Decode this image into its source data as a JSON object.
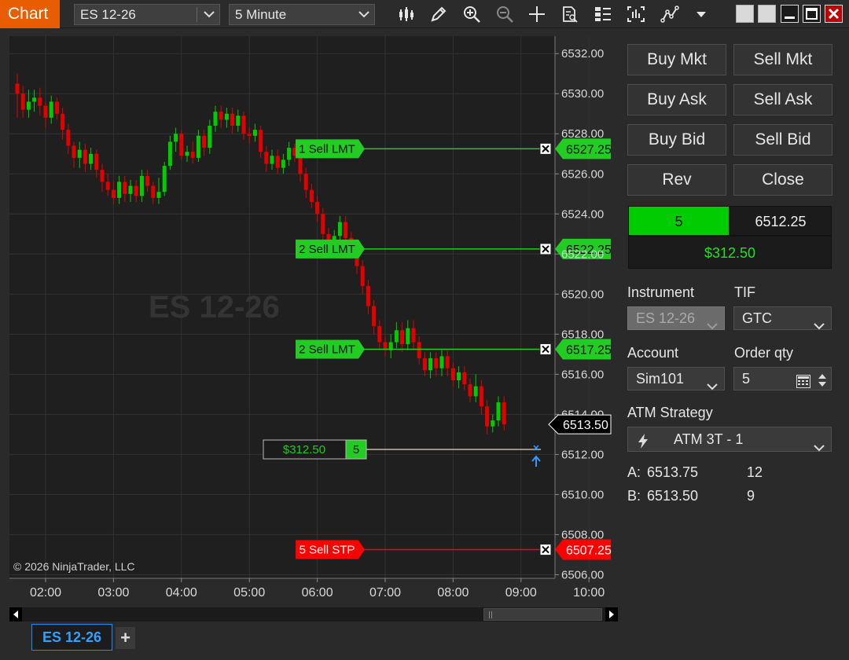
{
  "toolbar": {
    "app_title": "Chart",
    "instrument": "ES 12-26",
    "interval": "5 Minute"
  },
  "chart": {
    "watermark": "ES 12-26",
    "copyright": "© 2026 NinjaTrader, LLC",
    "y_labels": [
      "6532.00",
      "6530.00",
      "6528.00",
      "6526.00",
      "6524.00",
      "6522.00",
      "6520.00",
      "6518.00",
      "6516.00",
      "6514.00",
      "6512.00",
      "6510.00",
      "6508.00",
      "6506.00"
    ],
    "x_labels": [
      "02:00",
      "03:00",
      "04:00",
      "05:00",
      "06:00",
      "07:00",
      "08:00",
      "09:00",
      "10:00"
    ],
    "last_price": "6513.50",
    "orders": [
      {
        "label": "1 Sell LMT",
        "price": "6527.25",
        "type": "limit"
      },
      {
        "label": "2 Sell LMT",
        "price": "6522.25",
        "type": "limit"
      },
      {
        "label": "2 Sell LMT",
        "price": "6517.25",
        "type": "limit"
      },
      {
        "label": "5 Sell STP",
        "price": "6507.25",
        "type": "stop"
      }
    ],
    "position_pnl": "$312.50",
    "position_qty": "5"
  },
  "chart_data": {
    "type": "candlestick",
    "y_range": [
      6506,
      6532.5
    ],
    "candles": [
      [
        6530.5,
        6530.0,
        6531.0,
        6528.8
      ],
      [
        6530.0,
        6529.2,
        6530.4,
        6528.8
      ],
      [
        6529.2,
        6529.6,
        6530.2,
        6528.8
      ],
      [
        6529.6,
        6529.8,
        6530.2,
        6529.1
      ],
      [
        6529.8,
        6529.4,
        6530.3,
        6528.9
      ],
      [
        6529.4,
        6528.8,
        6529.6,
        6528.3
      ],
      [
        6528.8,
        6529.6,
        6529.9,
        6528.5
      ],
      [
        6529.6,
        6529.0,
        6529.8,
        6528.7
      ],
      [
        6529.0,
        6528.2,
        6529.3,
        6527.7
      ],
      [
        6528.2,
        6527.4,
        6528.5,
        6527.0
      ],
      [
        6527.4,
        6526.8,
        6527.6,
        6526.3
      ],
      [
        6526.8,
        6527.2,
        6527.6,
        6526.3
      ],
      [
        6527.2,
        6526.5,
        6527.5,
        6526.1
      ],
      [
        6526.5,
        6527.0,
        6527.3,
        6526.2
      ],
      [
        6527.0,
        6526.2,
        6527.2,
        6525.8
      ],
      [
        6526.2,
        6525.6,
        6526.5,
        6525.1
      ],
      [
        6525.6,
        6525.2,
        6526.0,
        6524.9
      ],
      [
        6525.2,
        6524.8,
        6525.6,
        6524.5
      ],
      [
        6524.8,
        6525.6,
        6525.9,
        6524.5
      ],
      [
        6525.6,
        6525.0,
        6525.9,
        6524.6
      ],
      [
        6525.0,
        6525.4,
        6525.7,
        6524.6
      ],
      [
        6525.4,
        6524.9,
        6525.7,
        6524.6
      ],
      [
        6524.9,
        6525.9,
        6526.2,
        6524.6
      ],
      [
        6525.9,
        6525.4,
        6526.2,
        6525.1
      ],
      [
        6525.4,
        6524.8,
        6525.6,
        6524.5
      ],
      [
        6524.8,
        6525.1,
        6525.8,
        6524.5
      ],
      [
        6525.1,
        6526.4,
        6526.6,
        6524.9
      ],
      [
        6526.4,
        6527.6,
        6527.9,
        6526.2
      ],
      [
        6527.6,
        6528.0,
        6528.3,
        6527.1
      ],
      [
        6528.0,
        6526.9,
        6528.2,
        6526.7
      ],
      [
        6526.9,
        6527.1,
        6527.4,
        6526.6
      ],
      [
        6527.1,
        6526.8,
        6527.6,
        6526.5
      ],
      [
        6526.8,
        6527.9,
        6528.2,
        6526.6
      ],
      [
        6527.9,
        6527.3,
        6528.2,
        6526.9
      ],
      [
        6527.3,
        6528.4,
        6528.7,
        6527.0
      ],
      [
        6528.4,
        6529.1,
        6529.4,
        6528.1
      ],
      [
        6529.1,
        6528.7,
        6529.4,
        6528.3
      ],
      [
        6528.7,
        6529.0,
        6529.3,
        6528.3
      ],
      [
        6529.0,
        6528.4,
        6529.3,
        6528.0
      ],
      [
        6528.4,
        6528.9,
        6529.2,
        6528.1
      ],
      [
        6528.9,
        6528.0,
        6529.1,
        6527.7
      ],
      [
        6528.0,
        6527.9,
        6528.3,
        6527.5
      ],
      [
        6527.9,
        6528.2,
        6528.5,
        6527.6
      ],
      [
        6528.2,
        6527.1,
        6528.4,
        6526.8
      ],
      [
        6527.1,
        6526.5,
        6527.4,
        6526.1
      ],
      [
        6526.5,
        6526.9,
        6527.2,
        6526.2
      ],
      [
        6526.9,
        6526.3,
        6527.2,
        6526.0
      ],
      [
        6526.3,
        6526.7,
        6527.0,
        6526.0
      ],
      [
        6526.7,
        6527.3,
        6527.6,
        6526.4
      ],
      [
        6527.3,
        6526.9,
        6527.5,
        6526.6
      ],
      [
        6526.9,
        6526.0,
        6527.1,
        6525.6
      ],
      [
        6526.0,
        6525.2,
        6526.3,
        6524.8
      ],
      [
        6525.2,
        6524.6,
        6525.5,
        6524.3
      ],
      [
        6524.6,
        6524.0,
        6524.9,
        6523.6
      ],
      [
        6524.0,
        6523.0,
        6524.3,
        6522.6
      ],
      [
        6523.0,
        6522.2,
        6523.3,
        6521.8
      ],
      [
        6522.2,
        6522.9,
        6523.2,
        6521.9
      ],
      [
        6522.9,
        6523.6,
        6523.9,
        6522.6
      ],
      [
        6523.6,
        6522.8,
        6523.9,
        6522.5
      ],
      [
        6522.8,
        6522.4,
        6523.1,
        6522.0
      ],
      [
        6522.4,
        6521.4,
        6522.7,
        6521.0
      ],
      [
        6521.4,
        6520.4,
        6521.7,
        6520.0
      ],
      [
        6520.4,
        6519.4,
        6520.7,
        6519.0
      ],
      [
        6519.4,
        6518.4,
        6519.7,
        6518.0
      ],
      [
        6518.4,
        6517.6,
        6518.7,
        6517.2
      ],
      [
        6517.6,
        6517.2,
        6517.9,
        6516.9
      ],
      [
        6517.2,
        6517.6,
        6518.0,
        6516.8
      ],
      [
        6517.6,
        6518.2,
        6518.6,
        6517.3
      ],
      [
        6518.2,
        6517.5,
        6518.6,
        6517.1
      ],
      [
        6517.5,
        6518.3,
        6518.7,
        6517.2
      ],
      [
        6518.3,
        6517.6,
        6518.7,
        6517.2
      ],
      [
        6517.6,
        6516.8,
        6517.9,
        6516.5
      ],
      [
        6516.8,
        6516.2,
        6517.1,
        6515.9
      ],
      [
        6516.2,
        6516.8,
        6517.1,
        6515.8
      ],
      [
        6516.8,
        6516.3,
        6517.1,
        6515.9
      ],
      [
        6516.3,
        6516.9,
        6517.2,
        6515.9
      ],
      [
        6516.9,
        6516.3,
        6517.2,
        6515.9
      ],
      [
        6516.3,
        6515.7,
        6516.6,
        6515.4
      ],
      [
        6515.7,
        6516.1,
        6516.4,
        6515.3
      ],
      [
        6516.1,
        6515.5,
        6516.4,
        6515.2
      ],
      [
        6515.5,
        6514.9,
        6515.8,
        6514.6
      ],
      [
        6514.9,
        6515.4,
        6516.0,
        6514.6
      ],
      [
        6515.4,
        6514.4,
        6515.7,
        6514.0
      ],
      [
        6514.4,
        6513.4,
        6514.7,
        6513.0
      ],
      [
        6513.4,
        6513.7,
        6514.0,
        6513.1
      ],
      [
        6513.7,
        6514.6,
        6514.9,
        6513.4
      ],
      [
        6514.6,
        6513.5,
        6514.9,
        6513.2
      ]
    ],
    "x_tick_index": [
      5,
      17,
      29,
      41,
      53,
      65,
      77,
      89,
      101
    ]
  },
  "panel": {
    "buttons": [
      "Buy Mkt",
      "Sell Mkt",
      "Buy Ask",
      "Sell Ask",
      "Buy Bid",
      "Sell Bid",
      "Rev",
      "Close"
    ],
    "position_qty": "5",
    "position_price": "6512.25",
    "position_pnl": "$312.50",
    "instrument_label": "Instrument",
    "instrument_value": "ES 12-26",
    "tif_label": "TIF",
    "tif_value": "GTC",
    "account_label": "Account",
    "account_value": "Sim101",
    "qty_label": "Order qty",
    "qty_value": "5",
    "atm_label": "ATM Strategy",
    "atm_value": "ATM 3T - 1",
    "ask_label": "A:",
    "ask_price": "6513.75",
    "ask_size": "12",
    "bid_label": "B:",
    "bid_price": "6513.50",
    "bid_size": "9"
  },
  "tabs": {
    "active": "ES 12-26",
    "add": "+"
  },
  "colors": {
    "accent": "#e85d00",
    "up": "#00cc00",
    "down": "#e50000",
    "limit": "#22cc22",
    "stop": "#ff0000",
    "tab": "#1a8cff"
  }
}
